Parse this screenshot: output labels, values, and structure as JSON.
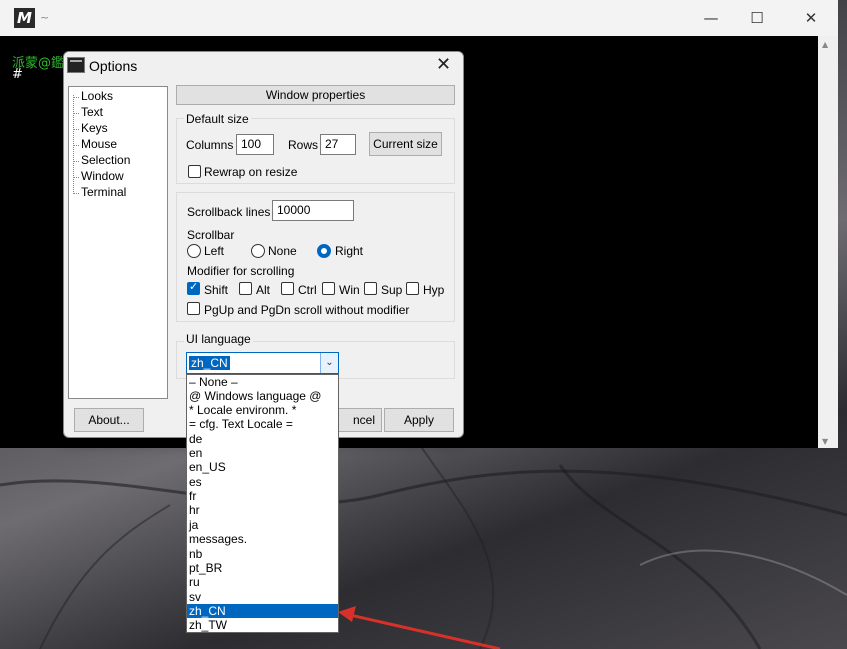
{
  "mintty": {
    "title": "~",
    "prompt": "派蒙@鑑",
    "hash": "#",
    "minimize": "—",
    "maximize": "☐",
    "close": "✕"
  },
  "dialog": {
    "title": "Options",
    "close": "✕",
    "tree": [
      "Looks",
      "Text",
      "Keys",
      "Mouse",
      "Selection",
      "Window",
      "Terminal"
    ],
    "window_properties": "Window properties",
    "default_size": {
      "group": "Default size",
      "columns_label": "Columns",
      "columns_value": "100",
      "rows_label": "Rows",
      "rows_value": "27",
      "current_size": "Current size",
      "rewrap": "Rewrap on resize"
    },
    "scroll": {
      "scrollback_label": "Scrollback lines",
      "scrollback_value": "10000",
      "scrollbar_label": "Scrollbar",
      "left": "Left",
      "none": "None",
      "right": "Right",
      "modifier_label": "Modifier for scrolling",
      "shift": "Shift",
      "alt": "Alt",
      "ctrl": "Ctrl",
      "win": "Win",
      "sup": "Sup",
      "hyp": "Hyp",
      "pgupdn": "PgUp and PgDn scroll without modifier"
    },
    "ui_language": {
      "label": "UI language",
      "value": "zh_CN",
      "options": [
        "– None –",
        "@ Windows language @",
        "* Locale environm. *",
        "= cfg. Text Locale =",
        "de",
        "en",
        "en_US",
        "es",
        "fr",
        "hr",
        "ja",
        "messages.",
        "nb",
        "pt_BR",
        "ru",
        "sv",
        "zh_CN",
        "zh_TW"
      ],
      "selected": "zh_CN"
    },
    "about": "About...",
    "cancel": "ncel",
    "apply": "Apply"
  },
  "colors": {
    "accent": "#0067c0",
    "annotation_arrow": "#d9302a",
    "prompt": "#2dbb2d"
  }
}
